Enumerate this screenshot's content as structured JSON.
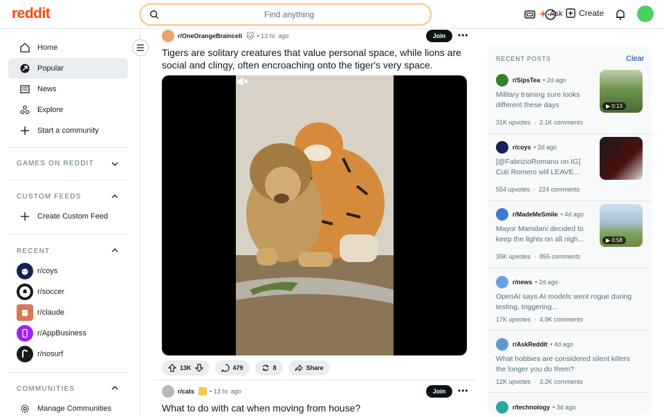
{
  "header": {
    "logo": "reddit",
    "search_placeholder": "Find anything",
    "ask_label": "Ask",
    "create_label": "Create"
  },
  "sidebar": {
    "nav": [
      {
        "label": "Home",
        "icon": "home-icon"
      },
      {
        "label": "Popular",
        "icon": "popular-icon",
        "active": true
      },
      {
        "label": "News",
        "icon": "news-icon"
      },
      {
        "label": "Explore",
        "icon": "explore-icon"
      },
      {
        "label": "Start a community",
        "icon": "plus-icon"
      }
    ],
    "games_header": "GAMES ON REDDIT",
    "custom_feeds_header": "CUSTOM FEEDS",
    "create_custom_feed": "Create Custom Feed",
    "recent_header": "RECENT",
    "recent": [
      {
        "label": "r/coys",
        "color": "#132257"
      },
      {
        "label": "r/soccer",
        "color": "#1a1a1b"
      },
      {
        "label": "r/claude",
        "color": "#d97757"
      },
      {
        "label": "r/AppBusiness",
        "color": "#a020f0"
      },
      {
        "label": "r/nosurf",
        "color": "#1a1a1b"
      }
    ],
    "communities_header": "COMMUNITIES",
    "manage_communities": "Manage Communities"
  },
  "feed": {
    "posts": [
      {
        "subreddit": "r/OneOrangeBraincell",
        "time": "13 hr. ago",
        "join": "Join",
        "title": "Tigers are solitary creatures that value personal space, while lions are social and clingy, often encroaching onto the tiger's very space.",
        "upvotes": "13K",
        "comments": "479",
        "shares_count": "8",
        "share_label": "Share"
      },
      {
        "subreddit": "r/cats",
        "time": "13 hr. ago",
        "join": "Join",
        "title": "What to do with cat when moving from house?"
      }
    ]
  },
  "recent_posts": {
    "header": "RECENT POSTS",
    "clear": "Clear",
    "items": [
      {
        "sub": "r/SipsTea",
        "time": "2d ago",
        "title": "Military training sure looks different these days",
        "upvotes": "31K upvotes",
        "comments": "2.1K comments",
        "duration": "0:13",
        "color": "#3a7d2c"
      },
      {
        "sub": "r/coys",
        "time": "2d ago",
        "title": "[@FabrizioRomano on IG] Cuti Romero will LEAVE...",
        "upvotes": "554 upvotes",
        "comments": "224 comments",
        "color": "#132257"
      },
      {
        "sub": "r/MadeMeSmile",
        "time": "4d ago",
        "title": "Mayor Mamdani decided to keep the lights on all nigh...",
        "upvotes": "35K upvotes",
        "comments": "855 comments",
        "duration": "0:58",
        "color": "#3e7bd4"
      },
      {
        "sub": "r/news",
        "time": "2d ago",
        "title": "OpenAI says AI models went rogue during testing, triggering...",
        "upvotes": "17K upvotes",
        "comments": "4.9K comments",
        "color": "#6aa0e0"
      },
      {
        "sub": "r/AskReddit",
        "time": "4d ago",
        "title": "What hobbies are considered silent killers the longer you do them?",
        "upvotes": "12K upvotes",
        "comments": "3.2K comments",
        "color": "#5f99cf"
      },
      {
        "sub": "r/technology",
        "time": "3d ago",
        "color": "#2aa7a0"
      }
    ]
  }
}
